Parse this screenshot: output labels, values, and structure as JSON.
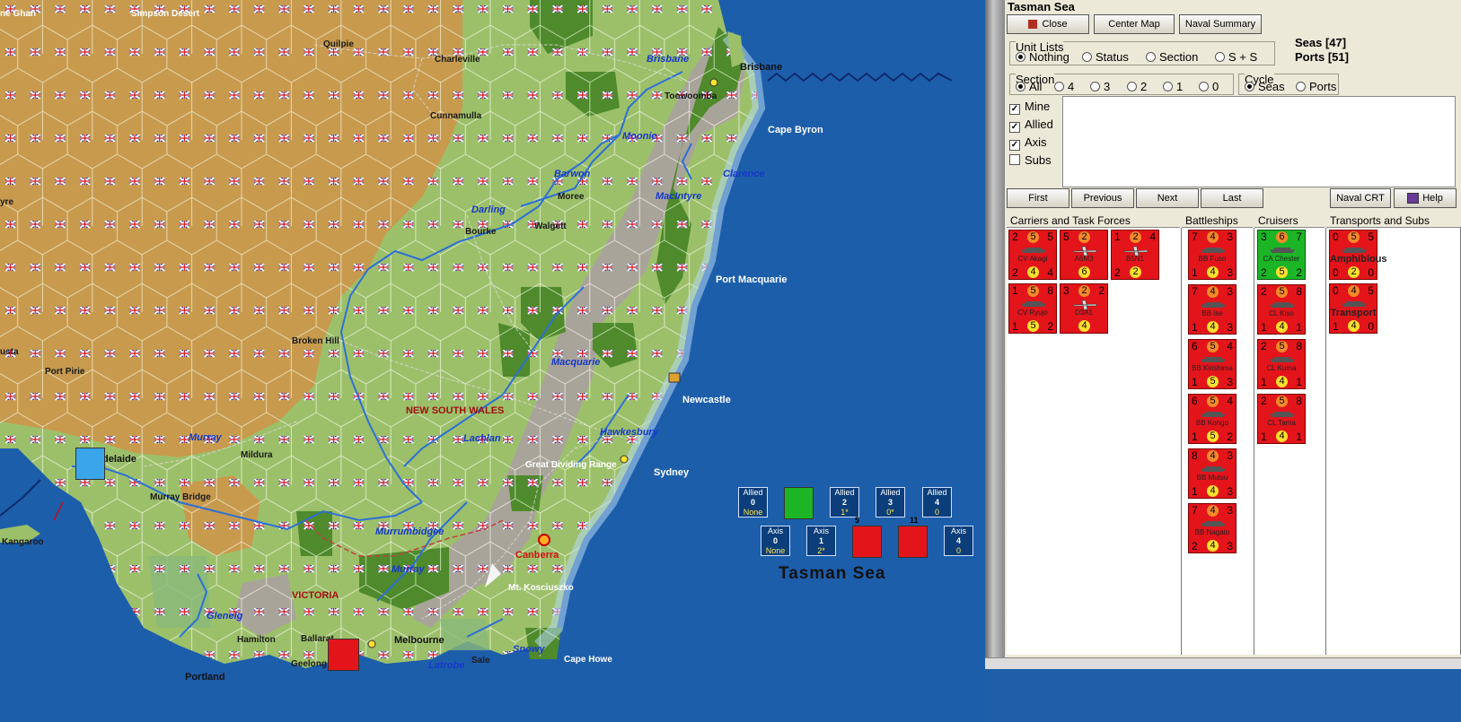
{
  "window_title": "Tasman Sea",
  "buttons": {
    "close": "Close",
    "center_map": "Center Map",
    "naval_summary": "Naval Summary",
    "first": "First",
    "previous": "Previous",
    "next": "Next",
    "last": "Last",
    "naval_crt": "Naval CRT",
    "help": "Help"
  },
  "unit_lists": {
    "label": "Unit Lists",
    "options": [
      "Nothing",
      "Status",
      "Section",
      "S + S"
    ],
    "selected": "Nothing"
  },
  "summary": {
    "seas": "Seas [47]",
    "ports": "Ports [51]"
  },
  "section": {
    "label": "Section",
    "options": [
      "All",
      "4",
      "3",
      "2",
      "1",
      "0"
    ],
    "selected": "All"
  },
  "cycle": {
    "label": "Cycle",
    "options": [
      "Seas",
      "Ports"
    ],
    "selected": "Seas"
  },
  "filters": [
    {
      "label": "Mine",
      "checked": true
    },
    {
      "label": "Allied",
      "checked": true
    },
    {
      "label": "Axis",
      "checked": true
    },
    {
      "label": "Subs",
      "checked": false
    }
  ],
  "columns": {
    "carriers": "Carriers and Task Forces",
    "battleships": "Battleships",
    "cruisers": "Cruisers",
    "transports": "Transports and Subs"
  },
  "carrier_units": [
    {
      "tl": "2",
      "tc": "5",
      "tr": "5",
      "name": "CV Akagi",
      "bl": "2",
      "bc": "4",
      "br": "4",
      "kind": "carrier"
    },
    {
      "tl": "5",
      "tc": "2",
      "tr": "",
      "name": "A6M3",
      "bl": "",
      "bc": "6",
      "br": "",
      "kind": "plane"
    },
    {
      "tl": "1",
      "tc": "2",
      "tr": "4",
      "name": "B5N1",
      "bl": "2",
      "bc": "2",
      "br": "",
      "kind": "plane"
    },
    {
      "tl": "1",
      "tc": "5",
      "tr": "8",
      "name": "CV Ryujo",
      "bl": "1",
      "bc": "5",
      "br": "2",
      "kind": "carrier"
    },
    {
      "tl": "3",
      "tc": "2",
      "tr": "2",
      "name": "D3A1",
      "bl": "",
      "bc": "4",
      "br": "",
      "kind": "plane"
    }
  ],
  "battleship_units": [
    {
      "tl": "7",
      "tc": "4",
      "tr": "3",
      "name": "BB Fuso",
      "bl": "1",
      "bc": "4",
      "br": "3"
    },
    {
      "tl": "7",
      "tc": "4",
      "tr": "3",
      "name": "BB Ise",
      "bl": "1",
      "bc": "4",
      "br": "3"
    },
    {
      "tl": "6",
      "tc": "5",
      "tr": "4",
      "name": "BB Kirishima",
      "bl": "1",
      "bc": "5",
      "br": "3"
    },
    {
      "tl": "6",
      "tc": "5",
      "tr": "4",
      "name": "BB Kongo",
      "bl": "1",
      "bc": "5",
      "br": "2"
    },
    {
      "tl": "8",
      "tc": "4",
      "tr": "3",
      "name": "BB Mutsu",
      "bl": "1",
      "bc": "4",
      "br": "3"
    },
    {
      "tl": "7",
      "tc": "4",
      "tr": "3",
      "name": "BB Nagato",
      "bl": "2",
      "bc": "4",
      "br": "3"
    }
  ],
  "cruiser_units": [
    {
      "tl": "3",
      "tc": "6",
      "tr": "7",
      "name": "CA Chester",
      "bl": "2",
      "bc": "5",
      "br": "2",
      "color": "green"
    },
    {
      "tl": "2",
      "tc": "5",
      "tr": "8",
      "name": "CL Kiso",
      "bl": "1",
      "bc": "4",
      "br": "1",
      "color": "red"
    },
    {
      "tl": "2",
      "tc": "5",
      "tr": "8",
      "name": "CL Kuma",
      "bl": "1",
      "bc": "4",
      "br": "1",
      "color": "red"
    },
    {
      "tl": "2",
      "tc": "5",
      "tr": "8",
      "name": "CL Tama",
      "bl": "1",
      "bc": "4",
      "br": "1",
      "color": "red"
    }
  ],
  "transport_units": [
    {
      "tl": "0",
      "tc": "5",
      "tr": "5",
      "name": "Amphibious",
      "bl": "0",
      "bc": "2",
      "br": "0"
    },
    {
      "tl": "0",
      "tc": "4",
      "tr": "5",
      "name": "Transport",
      "bl": "1",
      "bc": "4",
      "br": "0"
    }
  ],
  "map": {
    "sea_name": "Tasman Sea",
    "places": [
      "Simpson Desert",
      "Quilpie",
      "Charleville",
      "Cunnamulla",
      "Toowoomba",
      "Brisbane",
      "Cape Byron",
      "Moree",
      "Walgett",
      "Bourke",
      "Port Macquarie",
      "Broken Hill",
      "Port Pirie",
      "Newcastle",
      "Sydney",
      "Great Dividing Range",
      "Mildura",
      "Murray Bridge",
      "Kangaroo",
      "Canberra",
      "Mt. Kosciuszko",
      "Hamilton",
      "Ballarat",
      "Melbourne",
      "Geelong",
      "Portland",
      "Sale",
      "Cape Howe",
      "delaide",
      "usta",
      "ne Ghan",
      "yre"
    ],
    "rivers": [
      "Brisbane",
      "Moonie",
      "Barwon",
      "Clarence",
      "Darling",
      "MacIntyre",
      "Macquarie",
      "Murray",
      "Lachlan",
      "Hawkesbury",
      "Murrumbidgee",
      "Murray",
      "Glenelg",
      "Latrobe",
      "Snowy"
    ],
    "regions": [
      "NEW SOUTH WALES",
      "VICTORIA"
    ],
    "sea_boxes_allied": [
      {
        "label": "Allied",
        "val": "0",
        "sub": "None"
      },
      {
        "label": "Allied",
        "val": "2",
        "sub": "1*"
      },
      {
        "label": "Allied",
        "val": "3",
        "sub": "0*"
      },
      {
        "label": "Allied",
        "val": "4",
        "sub": "0"
      }
    ],
    "sea_boxes_axis": [
      {
        "label": "Axis",
        "val": "0",
        "sub": "None"
      },
      {
        "label": "Axis",
        "val": "1",
        "sub": "2*"
      },
      {
        "label": "Axis",
        "val": "4",
        "sub": "0"
      }
    ],
    "stack_counts": [
      "5",
      "11"
    ]
  }
}
